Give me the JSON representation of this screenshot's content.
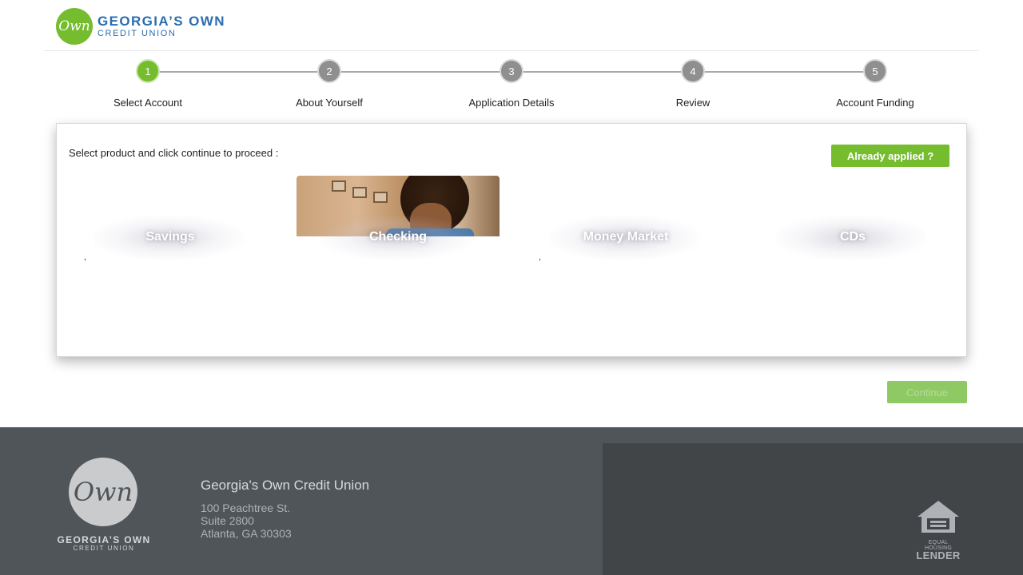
{
  "header": {
    "logo_mark": "Own",
    "logo_line1": "GEORGIA’S OWN",
    "logo_line2": "CREDIT UNION",
    "brand_color": "#76bc2f",
    "brand_text_color": "#2a6db0"
  },
  "stepper": {
    "current_step": 1,
    "steps": [
      {
        "number": "1",
        "label": "Select Account"
      },
      {
        "number": "2",
        "label": "About Yourself"
      },
      {
        "number": "3",
        "label": "Application Details"
      },
      {
        "number": "4",
        "label": "Review"
      },
      {
        "number": "5",
        "label": "Account Funding"
      }
    ]
  },
  "card": {
    "instructions": "Select product and click continue to proceed :",
    "already_applied_label": "Already applied ?",
    "products": [
      {
        "label": "Savings"
      },
      {
        "label": "Checking"
      },
      {
        "label": "Money Market"
      },
      {
        "label": "CDs"
      }
    ]
  },
  "continue_label": "Continue",
  "footer": {
    "logo_mark": "Own",
    "logo_line1": "GEORGIA’S OWN",
    "logo_line2": "CREDIT UNION",
    "org_name": "Georgia's Own Credit Union",
    "address_line1": "100 Peachtree St.",
    "address_line2": "Suite 2800",
    "address_line3": "Atlanta, GA 30303",
    "ehl_line1": "EQUAL HOUSING",
    "ehl_line2": "LENDER",
    "bg_color": "#505559"
  }
}
